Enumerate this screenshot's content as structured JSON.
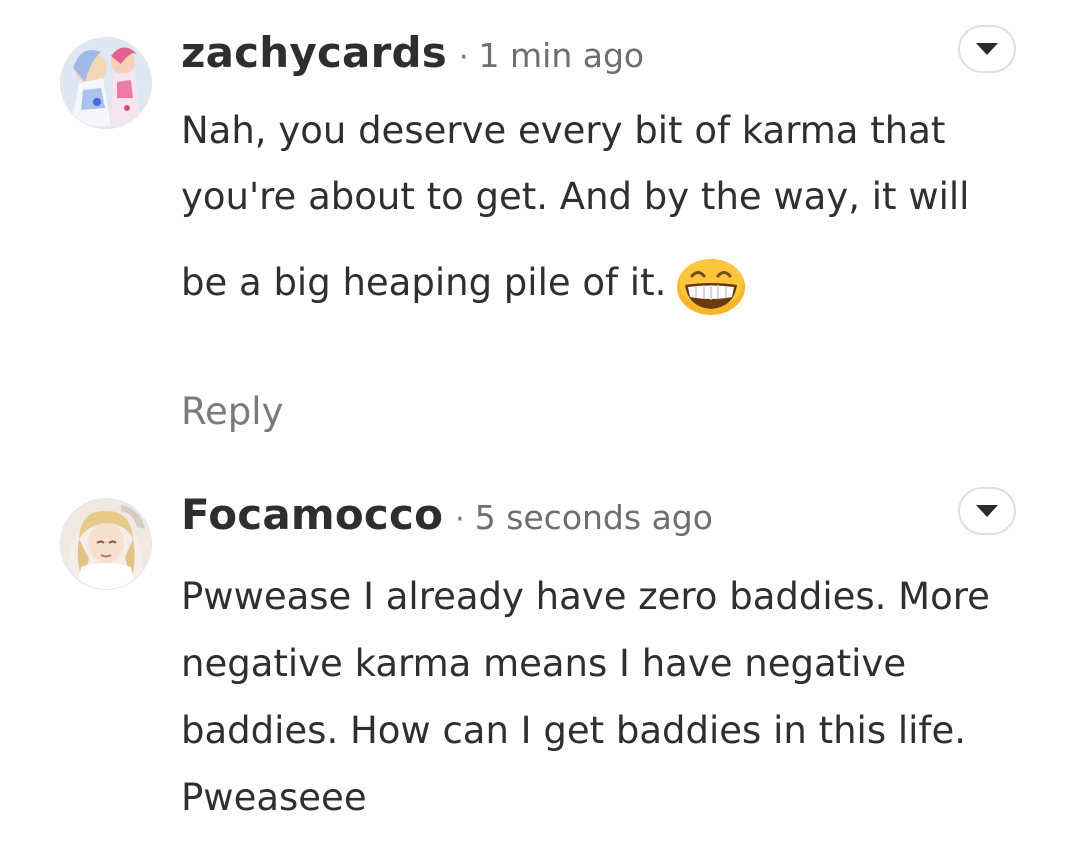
{
  "comments": [
    {
      "username": "zachycards",
      "separator": "·",
      "timestamp": "1 min ago",
      "lines": [
        "Nah, you deserve every bit of karma that",
        "you're about to get. And by the way, it will",
        "be a big heaping pile of it."
      ],
      "emoji": "grinning-face-emoji",
      "reply_label": "Reply",
      "menu_icon": "chevron-down-icon"
    },
    {
      "username": "Focamocco",
      "separator": "·",
      "timestamp": "5 seconds ago",
      "lines": [
        "Pwwease I already have zero baddies. More",
        "negative karma means I have negative",
        "baddies. How can I get baddies in this life.",
        "Pweaseee"
      ],
      "menu_icon": "chevron-down-icon"
    }
  ]
}
